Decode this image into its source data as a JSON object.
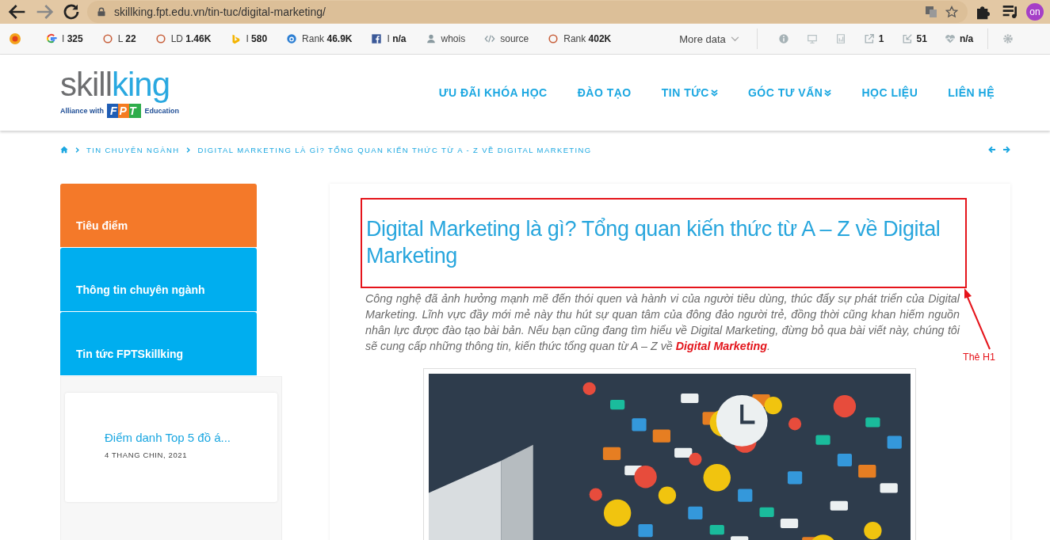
{
  "browser": {
    "url": "skillking.fpt.edu.vn/tin-tuc/digital-marketing/",
    "profile": "on"
  },
  "seo_toolbar": {
    "items": [
      {
        "kind": "google",
        "label": "I",
        "value": "325"
      },
      {
        "kind": "ring",
        "label": "L",
        "value": "22"
      },
      {
        "kind": "ring",
        "label": "LD",
        "value": "1.46K"
      },
      {
        "kind": "bing",
        "label": "I",
        "value": "580"
      },
      {
        "kind": "alexa",
        "label": "Rank",
        "value": "46.9K"
      },
      {
        "kind": "facebook",
        "label": "I",
        "value": "n/a"
      },
      {
        "kind": "person",
        "label": "whois"
      },
      {
        "kind": "code",
        "label": "source"
      },
      {
        "kind": "ring",
        "label": "Rank",
        "value": "402K"
      }
    ],
    "more": "More data",
    "stats": [
      {
        "kind": "info"
      },
      {
        "kind": "screen"
      },
      {
        "kind": "doc"
      },
      {
        "kind": "external",
        "value": "1"
      },
      {
        "kind": "internal",
        "value": "51"
      },
      {
        "kind": "heart",
        "value": "n/a"
      }
    ]
  },
  "logo": {
    "word_grey": "skill",
    "word_blue": "king",
    "alliance": "Alliance with",
    "badge": "FPT",
    "education": "Education"
  },
  "nav": [
    {
      "label": "ƯU ĐÃI KHÓA HỌC",
      "dropdown": false
    },
    {
      "label": "ĐÀO TẠO",
      "dropdown": false
    },
    {
      "label": "TIN TỨC",
      "dropdown": true
    },
    {
      "label": "GÓC TƯ VẤN",
      "dropdown": true
    },
    {
      "label": "HỌC LIỆU",
      "dropdown": false
    },
    {
      "label": "LIÊN HỆ",
      "dropdown": false
    }
  ],
  "breadcrumb": [
    "TIN CHUYÊN NGÀNH",
    "DIGITAL MARKETING LÀ GÌ? TỔNG QUAN KIẾN THỨC TỪ A - Z VỀ DIGITAL MARKETING"
  ],
  "sidebar": {
    "tabs": [
      {
        "label": "Tiêu điểm",
        "selected": true
      },
      {
        "label": "Thông tin chuyên ngành",
        "selected": false
      },
      {
        "label": "Tin tức FPTSkillking",
        "selected": false
      }
    ],
    "posts": [
      {
        "title": "Điểm danh Top 5 đồ á...",
        "date": "4 THANG CHIN, 2021"
      }
    ]
  },
  "article": {
    "title": "Digital Marketing là gì? Tổng quan kiến thức từ A – Z về Digital Marketing",
    "intro": "Công nghệ đã ảnh hưởng mạnh mẽ đến thói quen và hành vi của người tiêu dùng, thúc đẩy sự phát triển của Digital Marketing. Lĩnh vực đầy mới mẻ này thu hút sự quan tâm của đông đảo người trẻ, đồng thời cũng khan hiếm nguồn nhân lực được đào tạo bài bản. Nếu bạn cũng đang tìm hiểu về Digital Marketing, đừng bỏ qua bài viết này, chúng tôi sẽ cung cấp những thông tin, kiến thức tổng quan từ A – Z về **Digital Marketing**."
  },
  "annotation": {
    "label": "Thẻ H1"
  }
}
